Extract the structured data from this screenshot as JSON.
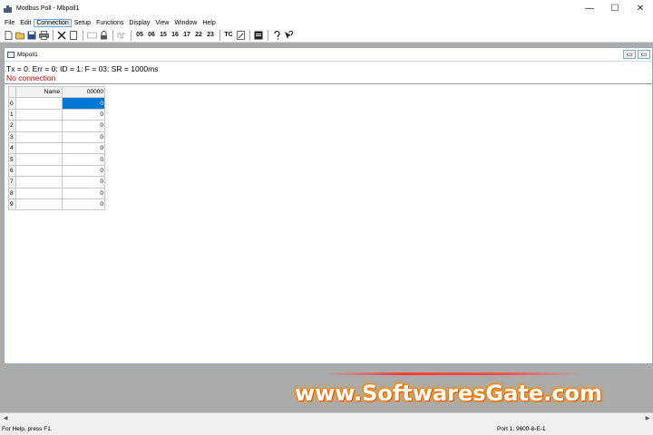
{
  "window": {
    "title": "Modbus Poll - Mbpoll1",
    "minimize": "—",
    "maximize": "☐",
    "close": "✕"
  },
  "menu": [
    "File",
    "Edit",
    "Connection",
    "Setup",
    "Functions",
    "Display",
    "View",
    "Window",
    "Help"
  ],
  "menu_active": "Connection",
  "toolbar": {
    "function_codes": [
      "05",
      "06",
      "15",
      "16",
      "17",
      "22",
      "23"
    ],
    "tc": "TC"
  },
  "child": {
    "title": "Mbpoll1",
    "status_line": "Tx = 0: Err = 0: ID = 1: F = 03: SR = 1000ms",
    "connection_status": "No connection",
    "connection_color": "#c00000",
    "columns": {
      "name": "Name",
      "address": "00000"
    },
    "rows": [
      {
        "index": "0",
        "name": "",
        "value": "0"
      },
      {
        "index": "1",
        "name": "",
        "value": "0"
      },
      {
        "index": "2",
        "name": "",
        "value": "0"
      },
      {
        "index": "3",
        "name": "",
        "value": "0"
      },
      {
        "index": "4",
        "name": "",
        "value": "0"
      },
      {
        "index": "5",
        "name": "",
        "value": "0"
      },
      {
        "index": "6",
        "name": "",
        "value": "0"
      },
      {
        "index": "7",
        "name": "",
        "value": "0"
      },
      {
        "index": "8",
        "name": "",
        "value": "0"
      },
      {
        "index": "9",
        "name": "",
        "value": "0"
      }
    ]
  },
  "watermark": "www.SoftwaresGate.com",
  "statusbar": {
    "help": "For Help, press F1.",
    "port": "Port 1: 9600-8-E-1"
  },
  "colors": {
    "selection": "#0078d7",
    "mdi_background": "#ababab"
  }
}
